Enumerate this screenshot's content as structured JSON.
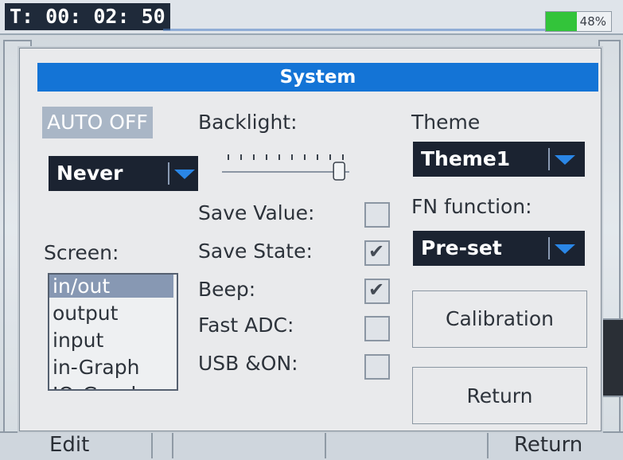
{
  "status_bar": {
    "timer": "T: 00: 02: 50",
    "battery_percent": "48%",
    "battery_level": 0.48
  },
  "dialog": {
    "title": "System",
    "auto_off": {
      "label": "AUTO OFF",
      "value": "Never"
    },
    "backlight": {
      "label": "Backlight:",
      "level": 0.92
    },
    "theme": {
      "label": "Theme",
      "value": "Theme1"
    },
    "fn_function": {
      "label": "FN function:",
      "value": "Pre-set"
    },
    "options": [
      {
        "label": "Save Value:",
        "checked": false
      },
      {
        "label": "Save State:",
        "checked": true
      },
      {
        "label": "Beep:",
        "checked": true
      },
      {
        "label": "Fast ADC:",
        "checked": false
      },
      {
        "label": "USB &ON:",
        "checked": false
      }
    ],
    "screen": {
      "label": "Screen:",
      "items": [
        "in/out",
        "output",
        "input",
        "in-Graph",
        "IO-Graph"
      ],
      "selected": "in/out"
    },
    "calibration_label": "Calibration",
    "return_label": "Return"
  },
  "softkeys": {
    "left": "Edit",
    "right": "Return"
  },
  "colors": {
    "title_bar": "#1474d6",
    "dropdown_bg": "#1b2331",
    "dropdown_arrow": "#2a86e6",
    "battery_fill": "#33c43a",
    "list_selected": "#8798b3"
  }
}
